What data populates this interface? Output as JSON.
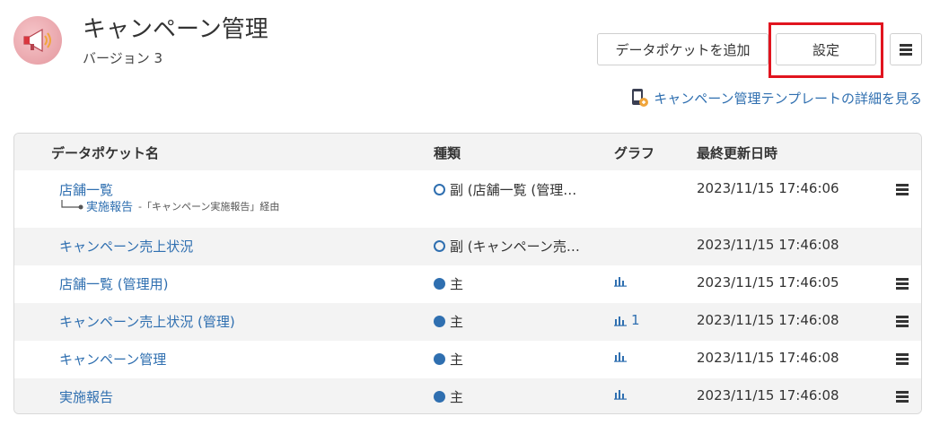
{
  "header": {
    "title": "キャンペーン管理",
    "version": "バージョン 3"
  },
  "toolbar": {
    "add_button": "データポケットを追加",
    "settings_button": "設定"
  },
  "template_link": "キャンペーン管理テンプレートの詳細を見る",
  "table": {
    "columns": [
      "データポケット名",
      "種類",
      "グラフ",
      "最終更新日時"
    ],
    "rows": [
      {
        "name": "店舗一覧",
        "sub_name": "実施報告",
        "sub_note": "-「キャンペーン実施報告」経由",
        "type": "副 (店舗一覧 (管理…",
        "type_kind": "sub",
        "graph": "",
        "updated": "2023/11/15 17:46:06"
      },
      {
        "name": "キャンペーン売上状況",
        "type": "副 (キャンペーン売…",
        "type_kind": "sub",
        "graph": "",
        "updated": "2023/11/15 17:46:08"
      },
      {
        "name": "店舗一覧 (管理用)",
        "type": "主",
        "type_kind": "main",
        "graph": "",
        "updated": "2023/11/15 17:46:05"
      },
      {
        "name": "キャンペーン売上状況 (管理)",
        "type": "主",
        "type_kind": "main",
        "graph": "1",
        "updated": "2023/11/15 17:46:08"
      },
      {
        "name": "キャンペーン管理",
        "type": "主",
        "type_kind": "main",
        "graph": "",
        "updated": "2023/11/15 17:46:08"
      },
      {
        "name": "実施報告",
        "type": "主",
        "type_kind": "main",
        "graph": "",
        "updated": "2023/11/15 17:46:08"
      }
    ]
  },
  "colors": {
    "link": "#2f6fb0",
    "highlight": "#e1141f",
    "stripe": "#f3f3f3"
  },
  "icons": [
    "megaphone-icon",
    "menu-icon",
    "template-icon",
    "bar-chart-icon",
    "sub-type-icon",
    "main-type-icon"
  ]
}
